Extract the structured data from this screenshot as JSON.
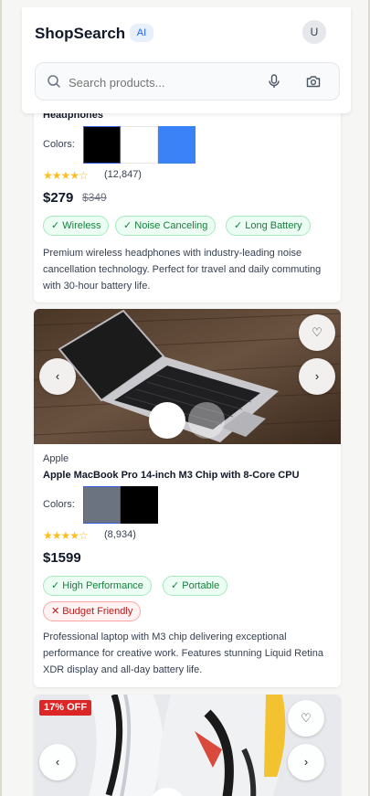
{
  "app": {
    "brand": "ShopSearch",
    "ai_badge": "AI",
    "avatar_initial": "U"
  },
  "search": {
    "placeholder": "Search products..."
  },
  "products": [
    {
      "title": "Headphones",
      "colors_label": "Colors:",
      "colors": [
        "#000000",
        "#ffffff",
        "#3b82f6"
      ],
      "rating_stars": "★★★★☆",
      "reviews": "(12,847)",
      "price": "$279",
      "old_price": "$349",
      "tags": [
        "✓ Wireless",
        "✓ Noise Canceling",
        "✓ Long Battery"
      ],
      "description": "Premium wireless headphones with industry-leading noise cancellation technology. Perfect for travel and daily commuting with 30-hour battery life."
    },
    {
      "brand": "Apple",
      "title": "Apple MacBook Pro 14-inch M3 Chip with 8-Core CPU",
      "colors_label": "Colors:",
      "colors": [
        "#6b7280",
        "#000000"
      ],
      "rating_stars": "★★★★☆",
      "reviews": "(8,934)",
      "price": "$1599",
      "tags": [
        "✓ High Performance",
        "✓ Portable"
      ],
      "neg_tags": [
        "✕ Budget Friendly"
      ],
      "description": "Professional laptop with M3 chip delivering exceptional performance for creative work. Features stunning Liquid Retina XDR display and all-day battery life."
    },
    {
      "discount": "17% OFF"
    }
  ],
  "icons": {
    "prev": "‹",
    "next": "›",
    "favorite": "♡"
  }
}
